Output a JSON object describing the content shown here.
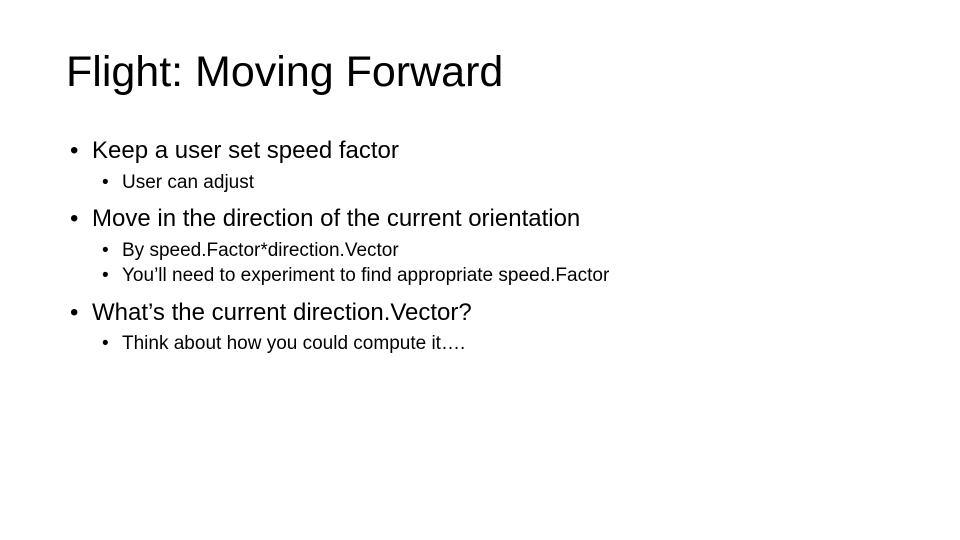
{
  "slide": {
    "title": "Flight: Moving Forward",
    "bullets": [
      {
        "text": "Keep a user set speed factor",
        "sub": [
          "User can adjust"
        ]
      },
      {
        "text": "Move in the direction of the current orientation",
        "sub": [
          "By speed.Factor*direction.Vector",
          "You’ll need to experiment to find appropriate speed.Factor"
        ]
      },
      {
        "text": "What’s the current direction.Vector?",
        "sub": [
          "Think about how you could compute it…."
        ]
      }
    ]
  }
}
